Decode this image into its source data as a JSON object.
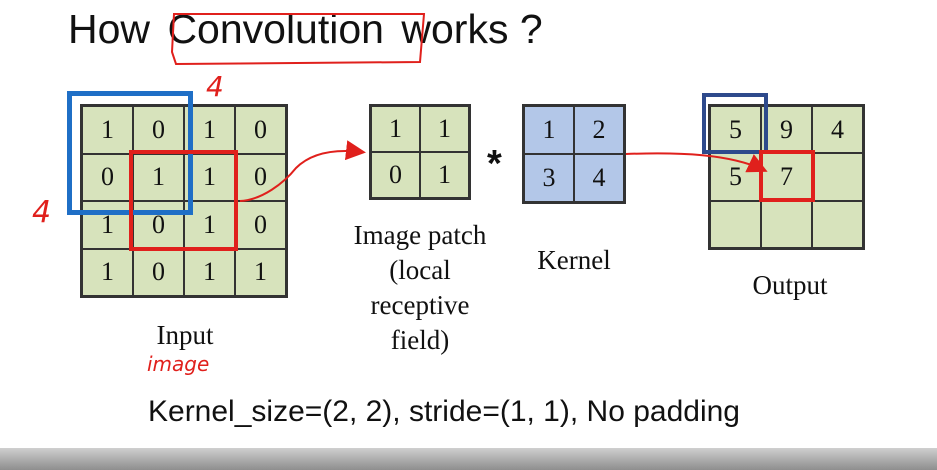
{
  "title": {
    "before": "How",
    "highlight": "Convolution",
    "after": "works ?"
  },
  "input": {
    "label": "Input",
    "values": [
      [
        1,
        0,
        1,
        0
      ],
      [
        0,
        1,
        1,
        0
      ],
      [
        1,
        0,
        1,
        0
      ],
      [
        1,
        0,
        1,
        1
      ]
    ]
  },
  "patch": {
    "label_lines": [
      "Image patch",
      "(local",
      "receptive",
      "field)"
    ],
    "values": [
      [
        1,
        1
      ],
      [
        0,
        1
      ]
    ]
  },
  "operator": "*",
  "kernel": {
    "label": "Kernel",
    "values": [
      [
        1,
        2
      ],
      [
        3,
        4
      ]
    ]
  },
  "output": {
    "label": "Output",
    "values": [
      [
        5,
        9,
        4
      ],
      [
        5,
        7,
        ""
      ],
      [
        "",
        "",
        ""
      ]
    ]
  },
  "footer": "Kernel_size=(2, 2), stride=(1, 1), No padding",
  "annotations": {
    "top_size": "4",
    "left_size": "4",
    "input_note": "image"
  },
  "colors": {
    "cell_green": "#d7e3bc",
    "cell_blue": "#b3c7e8",
    "window_blue": "#1f6fc6",
    "highlight_red": "#e0201c"
  }
}
